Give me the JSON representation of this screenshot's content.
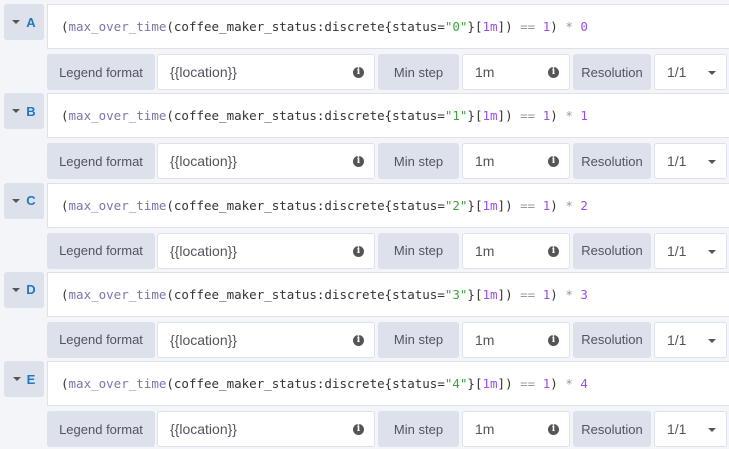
{
  "labels": {
    "legend_format": "Legend format",
    "min_step": "Min step",
    "resolution": "Resolution"
  },
  "queries": [
    {
      "ref": "A",
      "fn": "max_over_time",
      "metric": "coffee_maker_status:discrete",
      "label_key": "status",
      "label_value": "\"0\"",
      "range": "1m",
      "cmp": "==",
      "cmp_value": "1",
      "mult": "*",
      "mult_value": "0",
      "legend": "{{location}}",
      "min_step": "1m",
      "resolution": "1/1"
    },
    {
      "ref": "B",
      "fn": "max_over_time",
      "metric": "coffee_maker_status:discrete",
      "label_key": "status",
      "label_value": "\"1\"",
      "range": "1m",
      "cmp": "==",
      "cmp_value": "1",
      "mult": "*",
      "mult_value": "1",
      "legend": "{{location}}",
      "min_step": "1m",
      "resolution": "1/1"
    },
    {
      "ref": "C",
      "fn": "max_over_time",
      "metric": "coffee_maker_status:discrete",
      "label_key": "status",
      "label_value": "\"2\"",
      "range": "1m",
      "cmp": "==",
      "cmp_value": "1",
      "mult": "*",
      "mult_value": "2",
      "legend": "{{location}}",
      "min_step": "1m",
      "resolution": "1/1"
    },
    {
      "ref": "D",
      "fn": "max_over_time",
      "metric": "coffee_maker_status:discrete",
      "label_key": "status",
      "label_value": "\"3\"",
      "range": "1m",
      "cmp": "==",
      "cmp_value": "1",
      "mult": "*",
      "mult_value": "3",
      "legend": "{{location}}",
      "min_step": "1m",
      "resolution": "1/1"
    },
    {
      "ref": "E",
      "fn": "max_over_time",
      "metric": "coffee_maker_status:discrete",
      "label_key": "status",
      "label_value": "\"4\"",
      "range": "1m",
      "cmp": "==",
      "cmp_value": "1",
      "mult": "*",
      "mult_value": "4",
      "legend": "{{location}}",
      "min_step": "1m",
      "resolution": "1/1"
    }
  ]
}
